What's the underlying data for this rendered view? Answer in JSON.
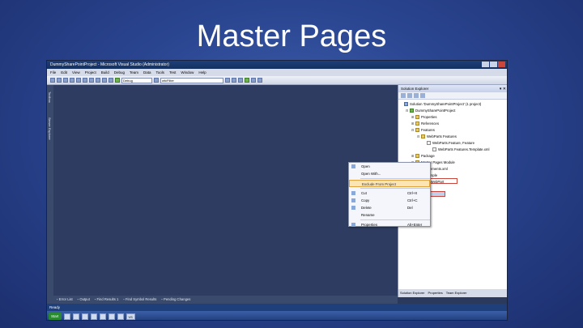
{
  "slide": {
    "title": "Master Pages"
  },
  "window": {
    "title": "DummySharePointProject - Microsoft Visual Studio (Administrator)",
    "menu": [
      "File",
      "Edit",
      "View",
      "Project",
      "Build",
      "Debug",
      "Team",
      "Data",
      "Tools",
      "Test",
      "Window",
      "Help"
    ],
    "toolbar": {
      "config_value": "Debug",
      "search_value": "wfcFilter"
    },
    "left_rail": [
      "Toolbox",
      "Server Explorer"
    ],
    "status_text": "Ready",
    "bottom_tabs": [
      "Error List",
      "Output",
      "Find Results 1",
      "Find Symbol Results",
      "Pending Changes"
    ]
  },
  "solution_explorer": {
    "title": "Solution Explorer",
    "pin": "▾ ✕",
    "tree": [
      {
        "label": "Solution 'DummySharePointProject' (1 project)",
        "icon": "solution",
        "indent": 0,
        "exp": ""
      },
      {
        "label": "DummySharePointProject",
        "icon": "project",
        "indent": 1,
        "exp": "⊟"
      },
      {
        "label": "Properties",
        "icon": "folder",
        "indent": 2,
        "exp": "⊞"
      },
      {
        "label": "References",
        "icon": "folder",
        "indent": 2,
        "exp": "⊞"
      },
      {
        "label": "Features",
        "icon": "folder",
        "indent": 2,
        "exp": "⊟"
      },
      {
        "label": "WebParts Features",
        "icon": "folder",
        "indent": 3,
        "exp": "⊟"
      },
      {
        "label": "WebParts.Feature, Feature",
        "icon": "file",
        "indent": 4,
        "exp": ""
      },
      {
        "label": "WebParts Features.Template.xml",
        "icon": "file",
        "indent": 5,
        "exp": ""
      },
      {
        "label": "Package",
        "icon": "folder",
        "indent": 2,
        "exp": "⊞"
      },
      {
        "label": "Master Pages Module",
        "icon": "folder",
        "indent": 2,
        "exp": "⊟"
      },
      {
        "label": "Elements.xml",
        "icon": "file",
        "indent": 3,
        "exp": ""
      },
      {
        "label": "Simple",
        "icon": "file",
        "indent": 3,
        "exp": ""
      },
      {
        "label": "VisualWebPart",
        "icon": "folder",
        "indent": 2,
        "exp": "⊞"
      },
      {
        "label": "snk",
        "icon": "file",
        "indent": 2,
        "exp": ""
      }
    ],
    "tabs": [
      "Solution Explorer",
      "Properties",
      "Team Explorer"
    ]
  },
  "context_menu": {
    "items": [
      {
        "label": "Open",
        "shortcut": "",
        "icon": "open-icon"
      },
      {
        "label": "Open With...",
        "shortcut": "",
        "icon": ""
      },
      {
        "sep": true
      },
      {
        "label": "Exclude From Project",
        "shortcut": "",
        "icon": "",
        "selected": true
      },
      {
        "sep": true
      },
      {
        "label": "Cut",
        "shortcut": "Ctrl+X",
        "icon": "cut-icon"
      },
      {
        "label": "Copy",
        "shortcut": "Ctrl+C",
        "icon": "copy-icon"
      },
      {
        "label": "Delete",
        "shortcut": "Del",
        "icon": "delete-icon"
      },
      {
        "label": "Rename",
        "shortcut": "",
        "icon": ""
      },
      {
        "sep": true
      },
      {
        "label": "Properties",
        "shortcut": "Alt+Enter",
        "icon": "properties-icon"
      }
    ]
  },
  "taskbar": {
    "start_label": "Start",
    "item_label": "VS"
  }
}
